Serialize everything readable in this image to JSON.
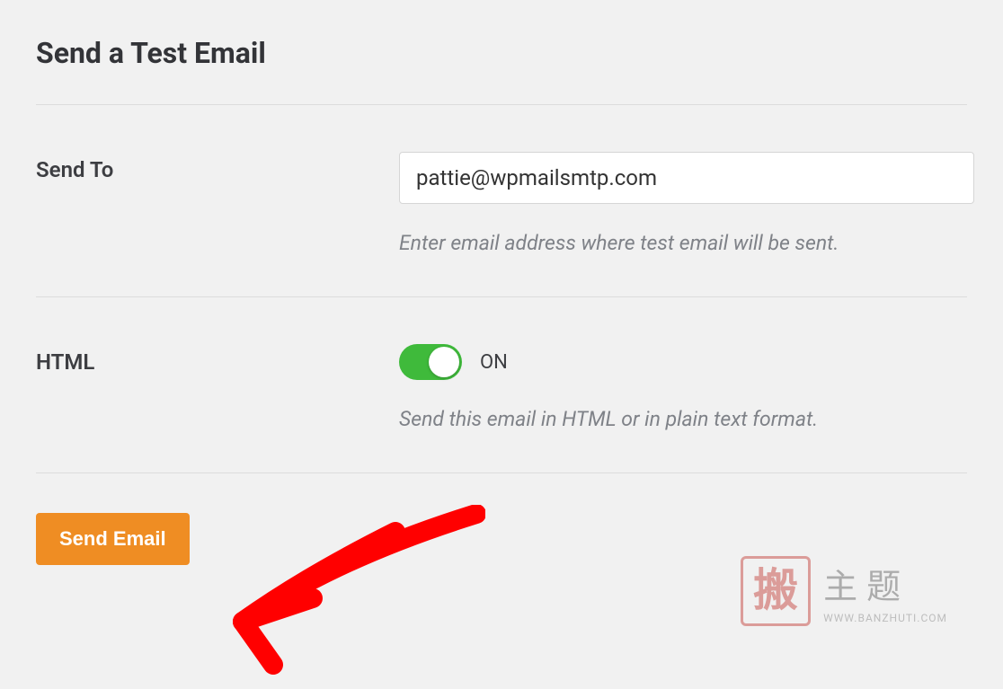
{
  "heading": "Send a Test Email",
  "sendTo": {
    "label": "Send To",
    "value": "pattie@wpmailsmtp.com",
    "help": "Enter email address where test email will be sent."
  },
  "html": {
    "label": "HTML",
    "state": "ON",
    "help": "Send this email in HTML or in plain text format."
  },
  "submit": {
    "label": "Send Email"
  },
  "colors": {
    "accent": "#ef8d23",
    "toggleOn": "#3fba3b",
    "arrow": "#ff0000"
  },
  "watermark": {
    "stamp": "搬",
    "main": "主题",
    "sub": "WWW.BANZHUTI.COM"
  }
}
